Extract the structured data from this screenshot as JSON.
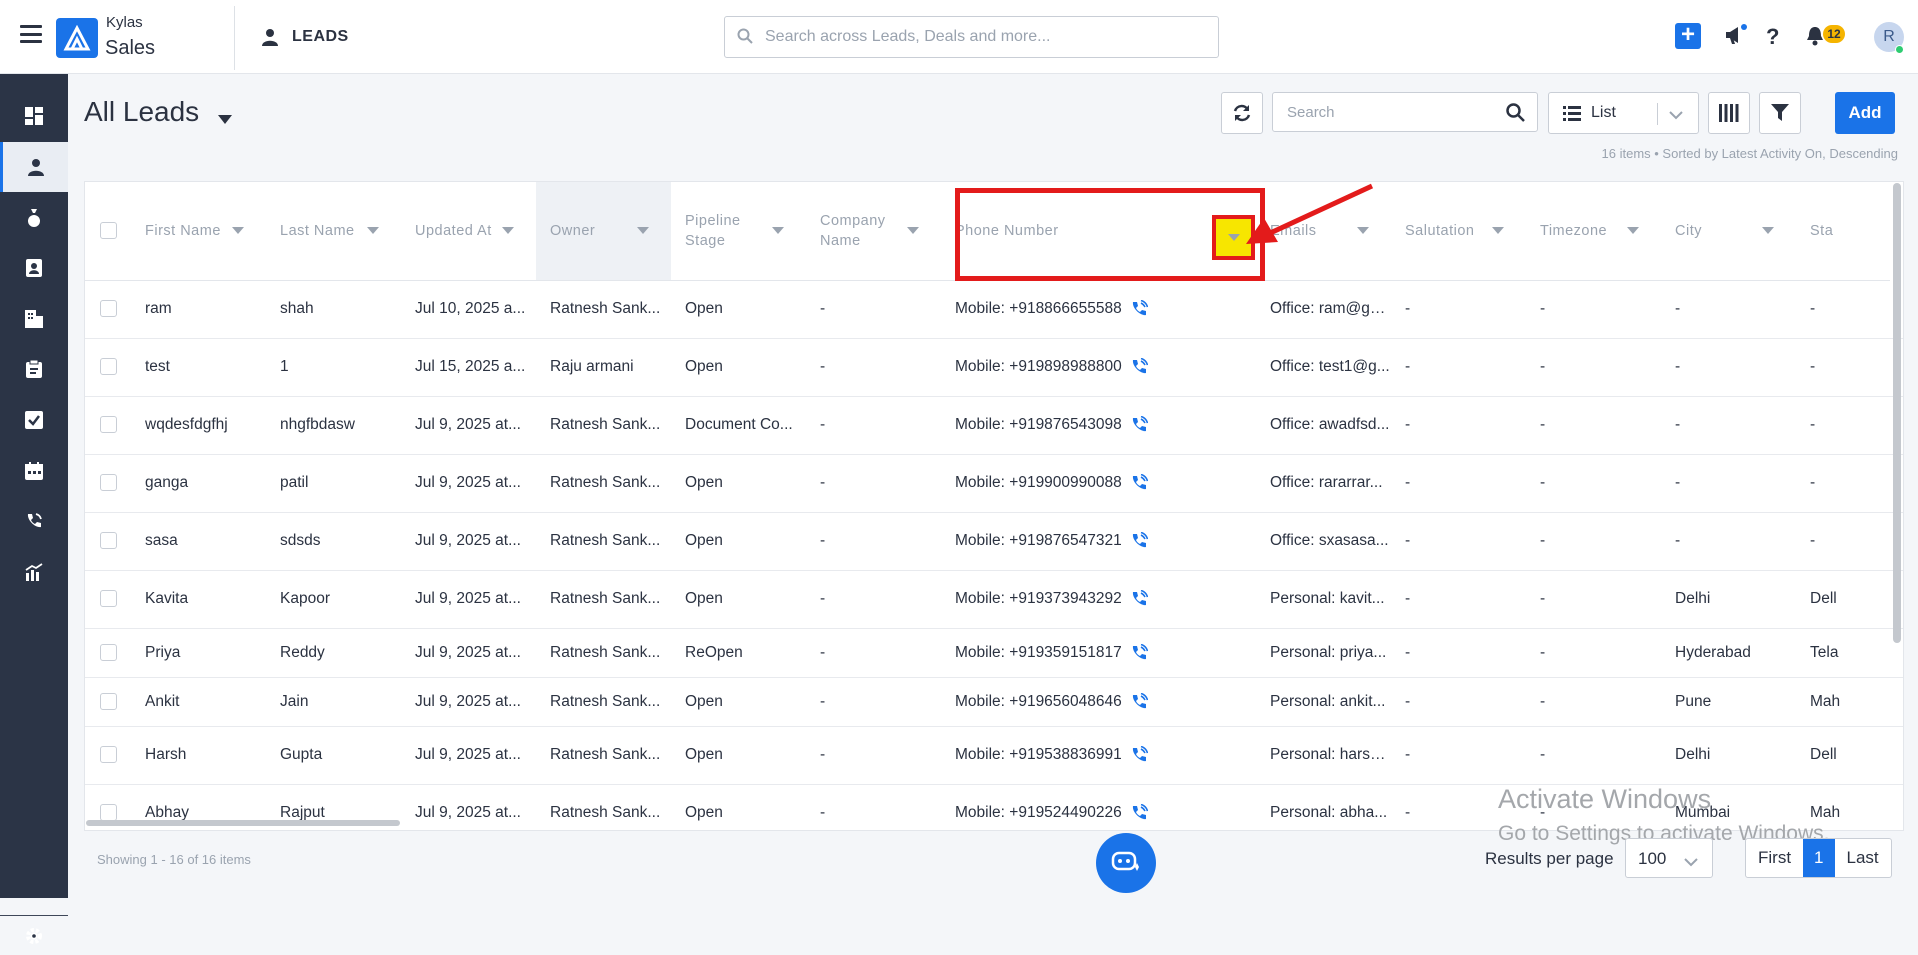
{
  "app": {
    "brand_small": "Kylas",
    "brand_big": "Sales",
    "module": "LEADS"
  },
  "global_search": {
    "placeholder": "Search across Leads, Deals and more..."
  },
  "notifications": {
    "count": "12"
  },
  "user": {
    "initial": "R"
  },
  "page": {
    "title": "All Leads",
    "search_placeholder": "Search",
    "view": "List",
    "add_label": "Add",
    "sort_info": "16 items • Sorted by Latest Activity On, Descending"
  },
  "columns": [
    "First Name",
    "Last Name",
    "Updated At",
    "Owner",
    "Pipeline Stage",
    "Company Name",
    "Phone Number",
    "Emails",
    "Salutation",
    "Timezone",
    "City",
    "Sta"
  ],
  "rows": [
    [
      "ram",
      "shah",
      "Jul 10, 2025 a...",
      "Ratnesh Sank...",
      "Open",
      "-",
      "Mobile: +918866655588",
      "Office: ram@gm...",
      "-",
      "-",
      "-",
      "-"
    ],
    [
      "test",
      "1",
      "Jul 15, 2025 a...",
      "Raju armani",
      "Open",
      "-",
      "Mobile: +919898988800",
      "Office: test1@g...",
      "-",
      "-",
      "-",
      "-"
    ],
    [
      "wqdesfdgfhj",
      "nhgfbdasw",
      "Jul 9, 2025 at...",
      "Ratnesh Sank...",
      "Document Co...",
      "-",
      "Mobile: +919876543098",
      "Office: awadfsd...",
      "-",
      "-",
      "-",
      "-"
    ],
    [
      "ganga",
      "patil",
      "Jul 9, 2025 at...",
      "Ratnesh Sank...",
      "Open",
      "-",
      "Mobile: +919900990088",
      "Office: rararrar...",
      "-",
      "-",
      "-",
      "-"
    ],
    [
      "sasa",
      "sdsds",
      "Jul 9, 2025 at...",
      "Ratnesh Sank...",
      "Open",
      "-",
      "Mobile: +919876547321",
      "Office: sxasasa...",
      "-",
      "-",
      "-",
      "-"
    ],
    [
      "Kavita",
      "Kapoor",
      "Jul 9, 2025 at...",
      "Ratnesh Sank...",
      "Open",
      "-",
      "Mobile: +919373943292",
      "Personal: kavit...",
      "-",
      "-",
      "Delhi",
      "Dell"
    ],
    [
      "Priya",
      "Reddy",
      "Jul 9, 2025 at...",
      "Ratnesh Sank...",
      "ReOpen",
      "-",
      "Mobile: +919359151817",
      "Personal: priya...",
      "-",
      "-",
      "Hyderabad",
      "Tela"
    ],
    [
      "Ankit",
      "Jain",
      "Jul 9, 2025 at...",
      "Ratnesh Sank...",
      "Open",
      "-",
      "Mobile: +919656048646",
      "Personal: ankit...",
      "-",
      "-",
      "Pune",
      "Mah"
    ],
    [
      "Harsh",
      "Gupta",
      "Jul 9, 2025 at...",
      "Ratnesh Sank...",
      "Open",
      "-",
      "Mobile: +919538836991",
      "Personal: harsh...",
      "-",
      "-",
      "Delhi",
      "Dell"
    ],
    [
      "Abhay",
      "Rajput",
      "Jul 9, 2025 at...",
      "Ratnesh Sank...",
      "Open",
      "-",
      "Mobile: +919524490226",
      "Personal: abha...",
      "-",
      "-",
      "Mumbai",
      "Mah"
    ]
  ],
  "footer": {
    "showing": "Showing 1 - 16 of 16 items",
    "rpp_label": "Results per page",
    "rpp_value": "100",
    "first": "First",
    "page": "1",
    "last": "Last"
  },
  "watermark": {
    "line1": "Activate Windows",
    "line2": "Go to Settings to activate Windows."
  },
  "colors": {
    "accent": "#1a73e8",
    "sidebar": "#2b3446",
    "highlight": "#e31b1b",
    "highlight_fill": "#f7e600"
  }
}
